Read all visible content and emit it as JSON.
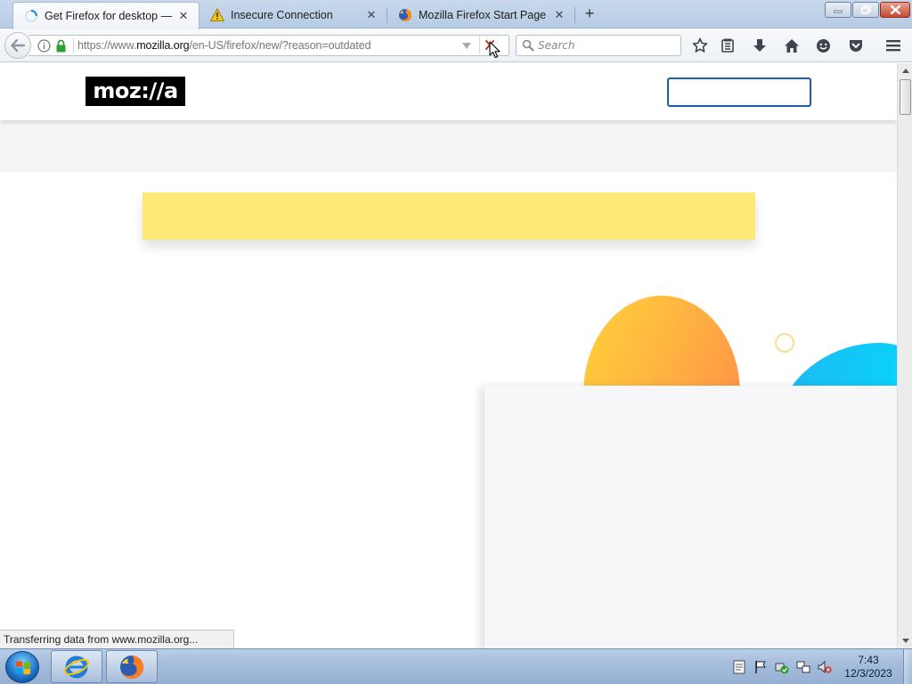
{
  "tabs": [
    {
      "title": "Get Firefox for desktop — ...",
      "icon": "loading-spinner-icon",
      "active": true
    },
    {
      "title": "Insecure Connection",
      "icon": "warning-icon",
      "active": false
    },
    {
      "title": "Mozilla Firefox Start Page",
      "icon": "firefox-icon",
      "active": false
    }
  ],
  "tab_close_glyph": "✕",
  "newtab_glyph": "+",
  "urlbar": {
    "prefix": "https://www.",
    "domain": "mozilla.org",
    "path": "/en-US/firefox/new/?reason=outdated"
  },
  "search": {
    "placeholder": "Search"
  },
  "page": {
    "logo_text": "moz://a",
    "colors": {
      "notice": "#fde878",
      "header_button_border": "#1c5fa8"
    }
  },
  "status_text": "Transferring data from www.mozilla.org...",
  "clock": {
    "time": "7:43",
    "date": "12/3/2023"
  }
}
